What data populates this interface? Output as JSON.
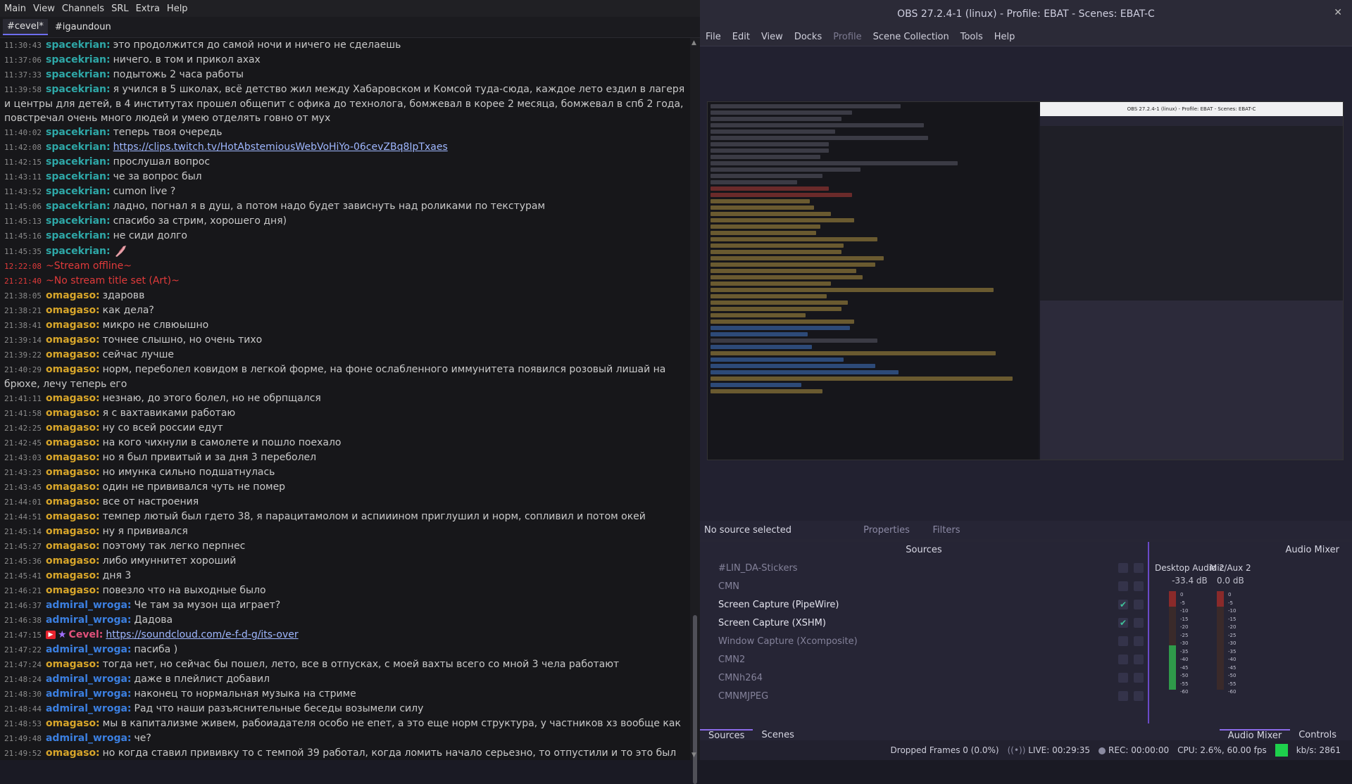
{
  "chat": {
    "menu": [
      "Main",
      "View",
      "Channels",
      "SRL",
      "Extra",
      "Help"
    ],
    "tabs": [
      {
        "label": "#cevel*",
        "active": true
      },
      {
        "label": "#igaundoun",
        "active": false
      }
    ],
    "messages": [
      {
        "ts": "11:30:43",
        "user": "spacekrian:",
        "cls": "u-space",
        "text": "это продолжится до самой ночи и ничего не сделаешь"
      },
      {
        "ts": "11:37:06",
        "user": "spacekrian:",
        "cls": "u-space",
        "text": "ничего. в том и прикол ахах"
      },
      {
        "ts": "11:37:33",
        "user": "spacekrian:",
        "cls": "u-space",
        "text": "подытожь 2 часа работы"
      },
      {
        "ts": "11:39:58",
        "user": "spacekrian:",
        "cls": "u-space",
        "text": "я учился в 5 школах, всё детство жил между Хабаровском и Комсой туда-сюда, каждое лето ездил в лагеря и центры для детей, в 4 институтах прошел общепит с офика до технолога, бомжевал в корее 2 месяца, бомжевал в спб 2 года, повстречал очень много людей и умею отделять говно от мух"
      },
      {
        "ts": "11:40:02",
        "user": "spacekrian:",
        "cls": "u-space",
        "text": "теперь твоя очередь"
      },
      {
        "ts": "11:42:08",
        "user": "spacekrian:",
        "cls": "u-space",
        "link": "https://clips.twitch.tv/HotAbstemiousWebVoHiYo-06cevZBq8IpTxaes"
      },
      {
        "ts": "11:42:15",
        "user": "spacekrian:",
        "cls": "u-space",
        "text": "прослушал вопрос"
      },
      {
        "ts": "11:43:11",
        "user": "spacekrian:",
        "cls": "u-space",
        "text": "че за вопрос был"
      },
      {
        "ts": "11:43:52",
        "user": "spacekrian:",
        "cls": "u-space",
        "text": "cumon live ?"
      },
      {
        "ts": "11:45:06",
        "user": "spacekrian:",
        "cls": "u-space",
        "text": "ладно, погнал я в душ, а потом надо будет зависнуть над роликами по текстурам"
      },
      {
        "ts": "11:45:13",
        "user": "spacekrian:",
        "cls": "u-space",
        "text": "спасибо за стрим, хорошего дня)"
      },
      {
        "ts": "11:45:16",
        "user": "spacekrian:",
        "cls": "u-space",
        "text": "не сиди долго"
      },
      {
        "ts": "11:45:35",
        "user": "spacekrian:",
        "cls": "u-space",
        "sticker": true
      },
      {
        "ts": "12:22:08",
        "system": true,
        "text": "~Stream offline~"
      },
      {
        "ts": "21:21:40",
        "system": true,
        "text": "~No stream title set (Art)~"
      },
      {
        "ts": "21:38:05",
        "user": "omagaso:",
        "cls": "u-omag",
        "text": "здаровв"
      },
      {
        "ts": "21:38:21",
        "user": "omagaso:",
        "cls": "u-omag",
        "text": "как дела?"
      },
      {
        "ts": "21:38:41",
        "user": "omagaso:",
        "cls": "u-omag",
        "text": "микро не слвюышно"
      },
      {
        "ts": "21:39:14",
        "user": "omagaso:",
        "cls": "u-omag",
        "text": "точнее слышно, но очень тихо"
      },
      {
        "ts": "21:39:22",
        "user": "omagaso:",
        "cls": "u-omag",
        "text": "сейчас лучше"
      },
      {
        "ts": "21:40:29",
        "user": "omagaso:",
        "cls": "u-omag",
        "text": "норм, переболел ковидом в легкой форме, на фоне ослабленного иммунитета появился розовый лишай на брюхе, лечу теперь его"
      },
      {
        "ts": "21:41:11",
        "user": "omagaso:",
        "cls": "u-omag",
        "text": "незнаю, до этого болел, но не обрпщался"
      },
      {
        "ts": "21:41:58",
        "user": "omagaso:",
        "cls": "u-omag",
        "text": "я с вахтавиками работаю"
      },
      {
        "ts": "21:42:25",
        "user": "omagaso:",
        "cls": "u-omag",
        "text": "ну со всей россии едут"
      },
      {
        "ts": "21:42:45",
        "user": "omagaso:",
        "cls": "u-omag",
        "text": "на кого чихнули в самолете и пошло поехало"
      },
      {
        "ts": "21:43:03",
        "user": "omagaso:",
        "cls": "u-omag",
        "text": "но я был привитый и за дня 3 переболел"
      },
      {
        "ts": "21:43:23",
        "user": "omagaso:",
        "cls": "u-omag",
        "text": "но имунка сильно подшатнулась"
      },
      {
        "ts": "21:43:45",
        "user": "omagaso:",
        "cls": "u-omag",
        "text": "один не прививался чуть не помер"
      },
      {
        "ts": "21:44:01",
        "user": "omagaso:",
        "cls": "u-omag",
        "text": "все от настроения"
      },
      {
        "ts": "21:44:51",
        "user": "omagaso:",
        "cls": "u-omag",
        "text": "темпер лютый был гдето 38, я парацитамолом и аспииином приглушил и норм, сопливил и потом окей"
      },
      {
        "ts": "21:45:14",
        "user": "omagaso:",
        "cls": "u-omag",
        "text": "ну я прививался"
      },
      {
        "ts": "21:45:27",
        "user": "omagaso:",
        "cls": "u-omag",
        "text": "поэтому так легко перпнес"
      },
      {
        "ts": "21:45:36",
        "user": "omagaso:",
        "cls": "u-omag",
        "text": "либо имуннитет хороший"
      },
      {
        "ts": "21:45:41",
        "user": "omagaso:",
        "cls": "u-omag",
        "text": "дня 3"
      },
      {
        "ts": "21:46:21",
        "user": "omagaso:",
        "cls": "u-omag",
        "text": "повезло что на выходные было"
      },
      {
        "ts": "21:46:37",
        "user": "admiral_wroga:",
        "cls": "u-adm",
        "text": "Че там за музон ща играет?"
      },
      {
        "ts": "21:46:38",
        "user": "admiral_wroga:",
        "cls": "u-adm",
        "text": "Дадова"
      },
      {
        "ts": "21:47:15",
        "user": "Cevel:",
        "cls": "u-cevel",
        "badges": true,
        "link": "https://soundcloud.com/e-f-d-g/its-over"
      },
      {
        "ts": "21:47:22",
        "user": "admiral_wroga:",
        "cls": "u-adm",
        "text": "пасиба )"
      },
      {
        "ts": "21:47:24",
        "user": "omagaso:",
        "cls": "u-omag",
        "text": "тогда нет, но сейчас бы пошел, лето, все в отпусках, с моей вахты всего со мной 3 чела работают"
      },
      {
        "ts": "21:48:24",
        "user": "admiral_wroga:",
        "cls": "u-adm",
        "text": "даже в плейлист добавил"
      },
      {
        "ts": "21:48:30",
        "user": "admiral_wroga:",
        "cls": "u-adm",
        "text": "наконец то нормальная музыка на стриме"
      },
      {
        "ts": "21:48:44",
        "user": "admiral_wroga:",
        "cls": "u-adm",
        "text": "Рад что наши разъяснительные беседы возымели силу"
      },
      {
        "ts": "21:48:53",
        "user": "omagaso:",
        "cls": "u-omag",
        "text": "мы в капитализме живем, рабоиадателя особо не епет, а это еще норм структура, у частников хз вообще как"
      },
      {
        "ts": "21:49:48",
        "user": "admiral_wroga:",
        "cls": "u-adm",
        "text": "че?"
      },
      {
        "ts": "21:49:52",
        "user": "omagaso:",
        "cls": "u-omag",
        "text": "но когда ставил прививку то с темпой 39 работал, когда ломить начало серьезно, то отпустили и то это был крайний день вахты"
      }
    ]
  },
  "obs": {
    "title": "OBS 27.2.4-1 (linux) - Profile: EBAT - Scenes: EBAT-C",
    "menu": [
      "File",
      "Edit",
      "View",
      "Docks",
      "Profile",
      "Scene Collection",
      "Tools",
      "Help"
    ],
    "no_source": "No source selected",
    "properties": "Properties",
    "filters": "Filters",
    "sources_title": "Sources",
    "sources": [
      {
        "name": "#LIN_DA-Stickers",
        "visible": false
      },
      {
        "name": "CMN",
        "visible": false
      },
      {
        "name": "Screen Capture (PipeWire)",
        "visible": true
      },
      {
        "name": "Screen Capture (XSHM)",
        "visible": true
      },
      {
        "name": "Window Capture (Xcomposite)",
        "visible": false
      },
      {
        "name": "CMN2",
        "visible": false
      },
      {
        "name": "CMNh264",
        "visible": false
      },
      {
        "name": "CMNMJPEG",
        "visible": false
      }
    ],
    "mixer_title": "Audio Mixer",
    "mixer_channels": [
      {
        "name": "Desktop Audio 2",
        "db": "-33.4 dB",
        "level": 0.45
      },
      {
        "name": "Mic/Aux 2",
        "db": "0.0 dB",
        "level": 0.0
      }
    ],
    "meter_scale": [
      "0",
      "-5",
      "-10",
      "-15",
      "-20",
      "-25",
      "-30",
      "-35",
      "-40",
      "-45",
      "-50",
      "-55",
      "-60"
    ],
    "dock_tabs": {
      "sources": "Sources",
      "scenes": "Scenes",
      "audio_mixer": "Audio Mixer",
      "controls": "Controls"
    },
    "status": {
      "dropped": "Dropped Frames 0 (0.0%)",
      "live": "LIVE: 00:29:35",
      "rec": "REC: 00:00:00",
      "cpu": "CPU: 2.6%, 60.00 fps",
      "kbs": "kb/s: 2861"
    },
    "preview_title": "OBS 27.2.4-1 (linux) - Profile: EBAT - Scenes: EBAT-C"
  }
}
